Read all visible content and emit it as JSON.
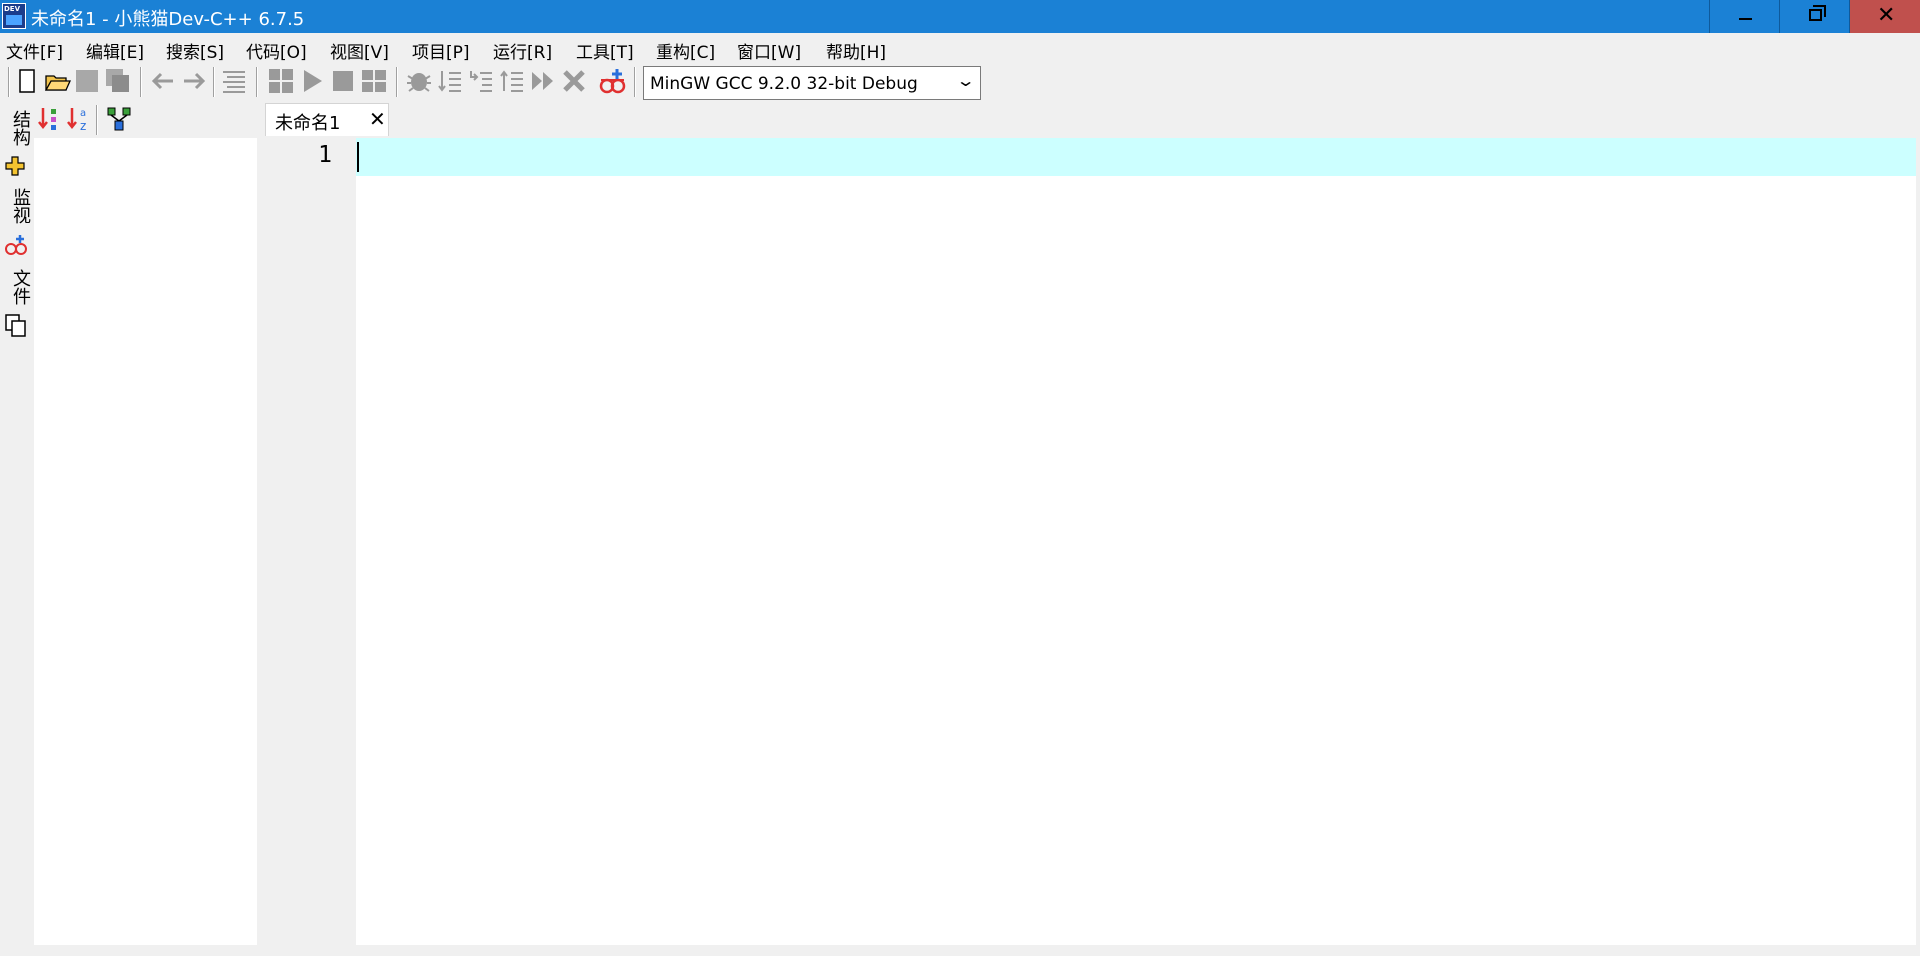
{
  "window": {
    "title": "未命名1 - 小熊猫Dev-C++ 6.7.5",
    "app_icon_text": "DEV",
    "minimize_label": "",
    "maximize_label": "",
    "close_label": "✕"
  },
  "menu": {
    "items": [
      "文件[F]",
      "编辑[E]",
      "搜索[S]",
      "代码[O]",
      "视图[V]",
      "项目[P]",
      "运行[R]",
      "工具[T]",
      "重构[C]",
      "窗口[W]",
      "帮助[H]"
    ]
  },
  "toolbar": {
    "icons": [
      "new-file-icon",
      "open-folder-icon",
      "save-icon",
      "save-all-icon",
      "back-arrow-icon",
      "forward-arrow-icon",
      "format-code-icon",
      "compile-icon",
      "run-icon",
      "stop-icon",
      "compile-run-icon",
      "debug-icon",
      "step-over-icon",
      "step-into-icon",
      "step-out-icon",
      "continue-icon",
      "stop-debug-icon",
      "add-watch-icon"
    ],
    "compiler": "MinGW GCC 9.2.0 32-bit Debug"
  },
  "sidebar": {
    "tabs": [
      "结构",
      "监视",
      "文件"
    ]
  },
  "class_browser": {
    "icons": [
      "sort-by-type-icon",
      "sort-alpha-icon",
      "show-inherited-icon"
    ]
  },
  "editor": {
    "tab_label": "未命名1",
    "tab_close": "✕",
    "line_numbers": [
      "1"
    ]
  },
  "colors": {
    "title_bar": "#1b81d5",
    "close_button": "#c0504d",
    "current_line": "#ccffff"
  }
}
